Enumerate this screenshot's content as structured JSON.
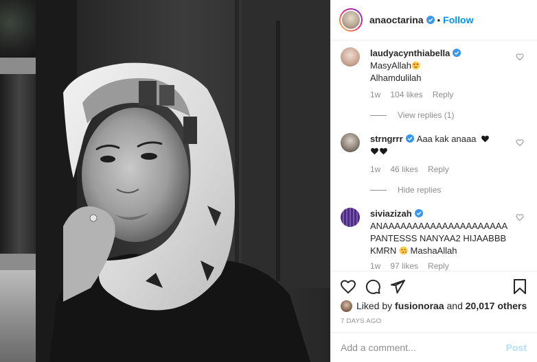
{
  "post": {
    "author": "anaoctarina",
    "follow_label": "Follow",
    "dot": "•",
    "likes_prefix": "Liked by",
    "likes_user": "fusionoraa",
    "likes_and": "and",
    "likes_others": "20,017 others",
    "timestamp": "7 DAYS AGO",
    "comment_placeholder": "Add a comment...",
    "post_label": "Post"
  },
  "comments": [
    {
      "user": "laudyacynthiabella",
      "line1": "MasyAllah",
      "line2": "Alhamdulilah",
      "age": "1w",
      "likes": "104 likes",
      "reply": "Reply",
      "replies_toggle": "View replies (1)"
    },
    {
      "user": "strngrrr",
      "line1": "Aaa kak anaaa",
      "age": "1w",
      "likes": "46 likes",
      "reply": "Reply",
      "replies_toggle": "Hide replies"
    },
    {
      "user": "siviazizah",
      "line1": "ANAAAAAAAAAAAAAAAAAAAAA",
      "line2": "PANTESSS NANYAA2 HIJAABBB",
      "line3": "KMRN",
      "line3_tail": "MashaAllah",
      "age": "1w",
      "likes": "97 likes",
      "reply": "Reply"
    }
  ],
  "colors": {
    "accent": "#0095f6",
    "verified": "#3897f0",
    "muted": "#8e8e8e",
    "text": "#262626",
    "post_disabled": "#b2dffc"
  },
  "icons": [
    "verified-badge-icon",
    "heart-outline-icon",
    "comment-bubble-icon",
    "share-plane-icon",
    "bookmark-icon",
    "heart-eyes-emoji",
    "black-heart-emoji",
    "kiss-emoji"
  ]
}
